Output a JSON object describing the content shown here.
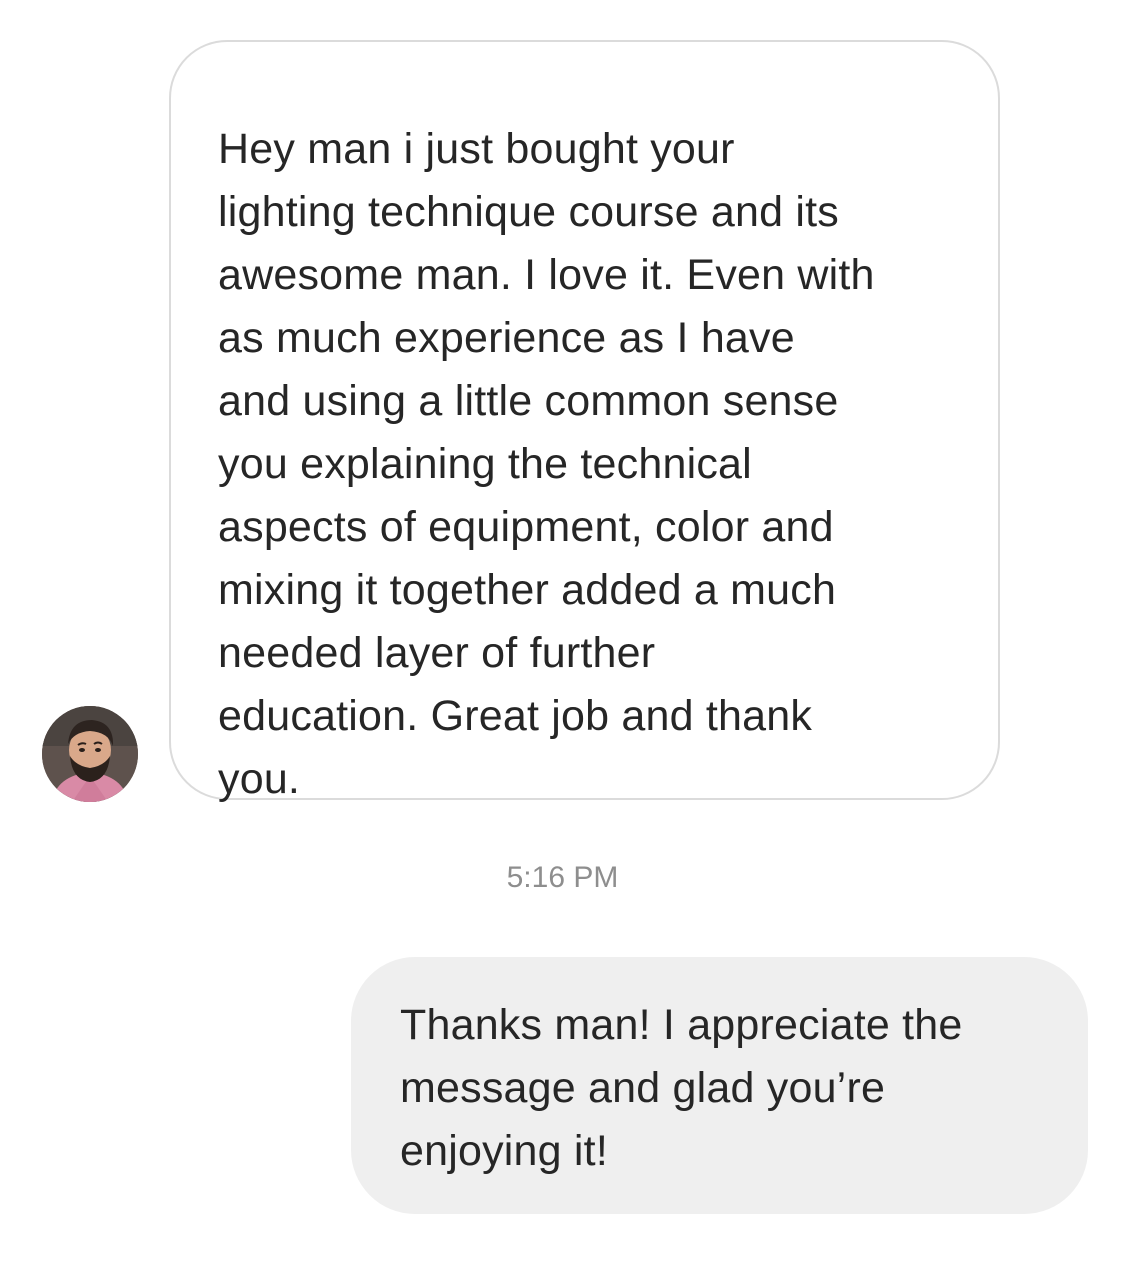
{
  "conversation": {
    "incoming_message": "Hey man i just bought your\nlighting technique course and its\nawesome man. I love it. Even with\nas much experience as I have\nand using a little common sense\nyou explaining the technical\naspects of equipment, color and\nmixing it together added a much\nneeded layer of further\neducation. Great job and thank\nyou.",
    "timestamp": "5:16 PM",
    "outgoing_message": "Thanks man! I appreciate the\nmessage and glad you’re\nenjoying it!"
  },
  "colors": {
    "incoming_bubble_border": "#dbdbdb",
    "outgoing_bubble_fill": "#efefef",
    "text": "#262626",
    "timestamp": "#8e8e8e"
  }
}
